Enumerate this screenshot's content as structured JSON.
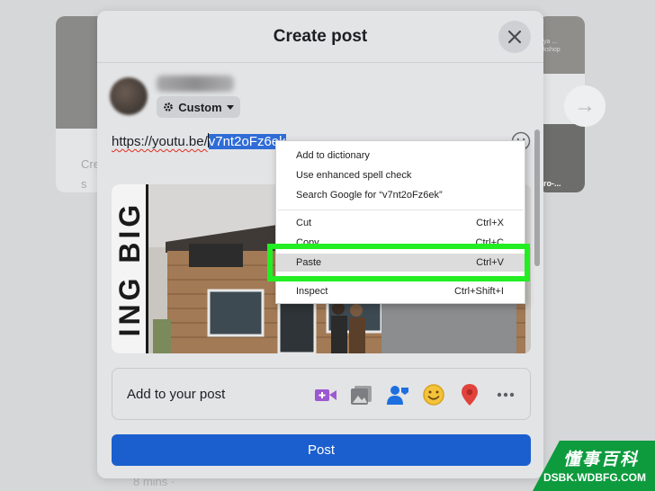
{
  "background": {
    "left_card_text": [
      "Cre",
      "s"
    ],
    "right_card_text": [
      "ya ...",
      "kshop"
    ],
    "right_card_caption": "ro-...",
    "bottom_timestamp": "8 mins · "
  },
  "modal": {
    "title": "Create post",
    "privacy_label": "Custom",
    "post_text_plain": "https://youtu.be/",
    "post_text_selected": "v7nt2oFz6ek",
    "add_to_post_label": "Add to your post",
    "post_button": "Post"
  },
  "context_menu": {
    "items": [
      {
        "label": "Add to dictionary",
        "shortcut": ""
      },
      {
        "label": "Use enhanced spell check",
        "shortcut": ""
      },
      {
        "label": "Search Google for “v7nt2oFz6ek”",
        "shortcut": ""
      },
      {
        "label": "Cut",
        "shortcut": "Ctrl+X"
      },
      {
        "label": "Copy",
        "shortcut": "Ctrl+C"
      },
      {
        "label": "Paste",
        "shortcut": "Ctrl+V"
      },
      {
        "label": "Inspect",
        "shortcut": "Ctrl+Shift+I"
      }
    ],
    "highlighted_item": "Paste"
  },
  "preview": {
    "overlay_text": "ING BIG"
  },
  "watermark": {
    "cn": "懂事百科",
    "en": "DSBK.WDBFG.COM"
  },
  "colors": {
    "post_button": "#1b5fcf",
    "selection": "#2f6cd6",
    "highlight_box": "#22ee22",
    "video_icon": "#9b59d0",
    "tag_icon": "#1d6fe0",
    "feeling_icon": "#e8b423",
    "location_icon": "#e0433b"
  },
  "icons": [
    "close-icon",
    "gear-icon",
    "emoji-icon",
    "video-icon",
    "photo-icon",
    "tag-people-icon",
    "feeling-icon",
    "location-icon",
    "more-icon",
    "chevron-right-icon"
  ]
}
